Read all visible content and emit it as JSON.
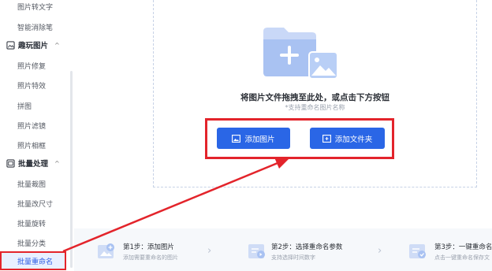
{
  "sidebar": {
    "top_items": [
      {
        "label": "图片转文字"
      },
      {
        "label": "智能消除笔"
      }
    ],
    "groups": [
      {
        "label": "趣玩图片",
        "icon": "image-grid-icon",
        "items": [
          {
            "label": "照片修复"
          },
          {
            "label": "照片特效"
          },
          {
            "label": "拼图"
          },
          {
            "label": "照片滤镜"
          },
          {
            "label": "照片相框"
          }
        ]
      },
      {
        "label": "批量处理",
        "icon": "batch-icon",
        "items": [
          {
            "label": "批量裁图"
          },
          {
            "label": "批量改尺寸"
          },
          {
            "label": "批量旋转"
          },
          {
            "label": "批量分类"
          },
          {
            "label": "批量重命名"
          }
        ]
      }
    ]
  },
  "dropzone": {
    "hint_main": "将图片文件拖拽至此处，或点击下方按钮",
    "hint_sub": "*支持重命名图片名称",
    "add_image_label": "添加图片",
    "add_folder_label": "添加文件夹"
  },
  "steps": [
    {
      "title": "第1步：添加图片",
      "desc": "添加需要重命名的图片"
    },
    {
      "title": "第2步：选择重命名参数",
      "desc": "支持选择时间数字"
    },
    {
      "title": "第3步：一键重命名",
      "desc": "点击一键重命名保存文"
    }
  ],
  "colors": {
    "accent": "#2a66e6",
    "highlight_red": "#e3242b",
    "active_bg": "#e9f0ff"
  }
}
